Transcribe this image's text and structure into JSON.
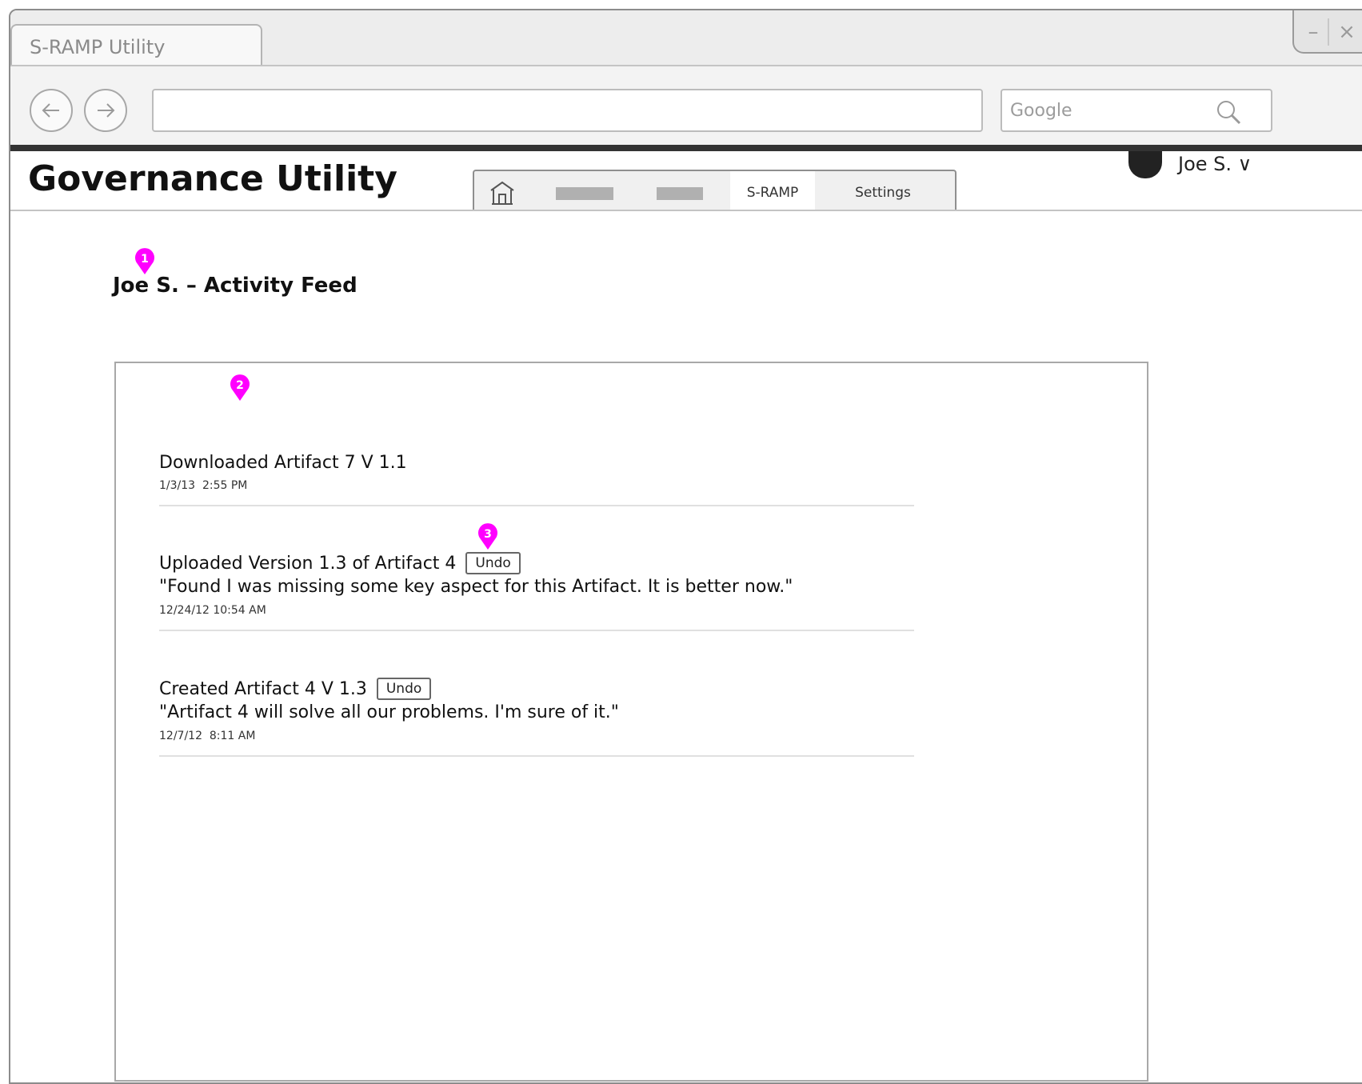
{
  "browser": {
    "tab_title": "S-RAMP Utility",
    "address": "",
    "search_placeholder": "Google",
    "minimize_glyph": "–",
    "close_glyph": "×"
  },
  "app": {
    "title": "Governance Utility",
    "nav": {
      "home_icon": "home-icon",
      "items": [
        "S-RAMP",
        "Settings"
      ],
      "active": "S-RAMP"
    },
    "user_menu": "Joe S. ∨"
  },
  "page": {
    "heading": "Joe S. – Activity Feed"
  },
  "markers": [
    "1",
    "2",
    "3"
  ],
  "feed": [
    {
      "title": "Downloaded Artifact 7 V 1.1",
      "quote": "",
      "timestamp": "1/3/13  2:55 PM",
      "undo": false
    },
    {
      "title": "Uploaded Version 1.3 of Artifact 4",
      "quote": "\"Found I was missing some key aspect for this Artifact.  It is better now.\"",
      "timestamp": "12/24/12 10:54 AM",
      "undo": true,
      "undo_label": "Undo"
    },
    {
      "title": "Created Artifact 4 V 1.3",
      "quote": "\"Artifact 4 will solve all our problems.  I'm sure of it.\"",
      "timestamp": "12/7/12  8:11 AM",
      "undo": true,
      "undo_label": "Undo"
    }
  ],
  "colors": {
    "marker": "#ff00ff",
    "header_bar": "#333333"
  }
}
